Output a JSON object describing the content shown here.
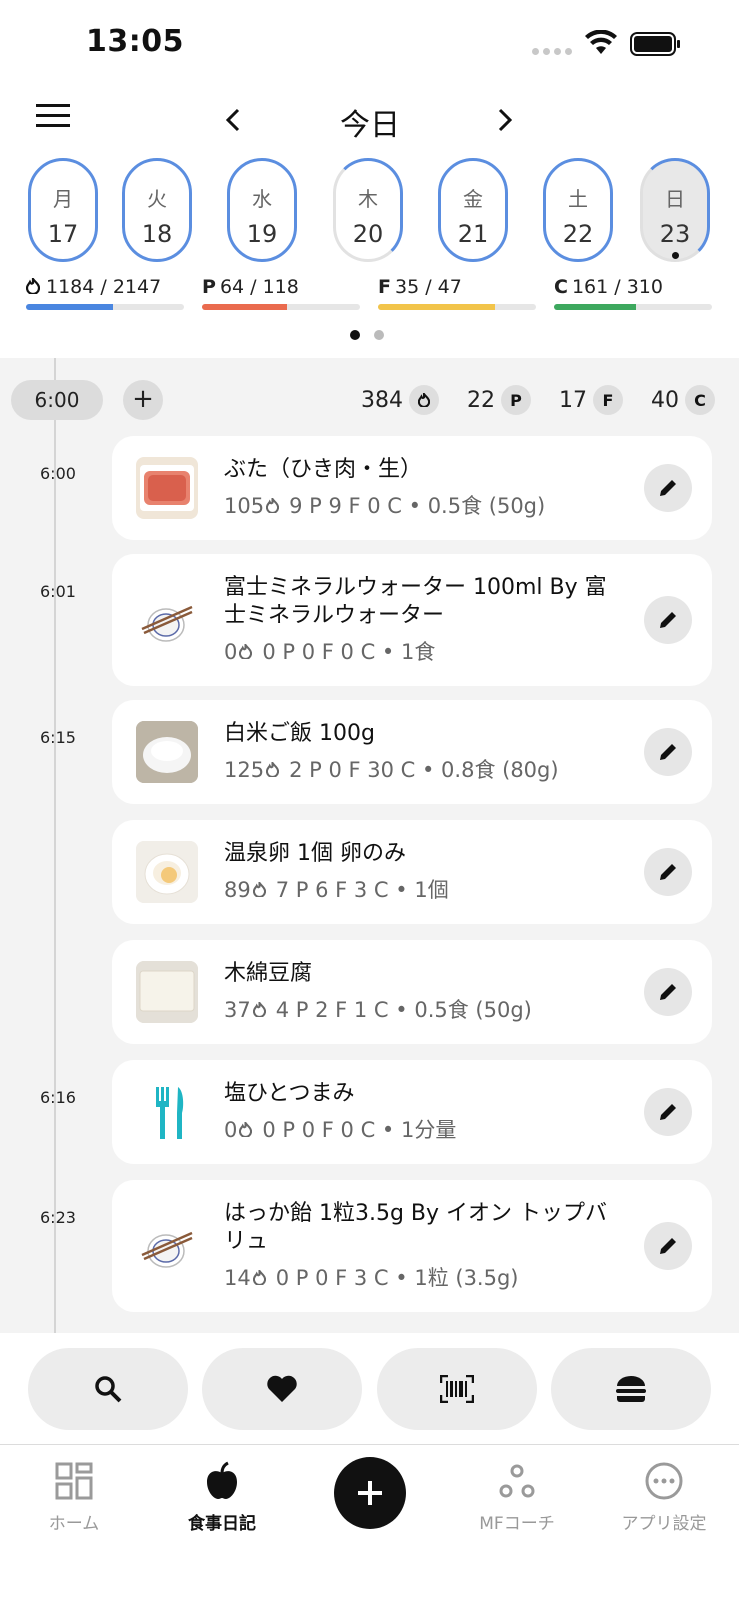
{
  "status": {
    "time": "13:05"
  },
  "header": {
    "title": "今日"
  },
  "week": [
    {
      "name": "月",
      "num": "17"
    },
    {
      "name": "火",
      "num": "18"
    },
    {
      "name": "水",
      "num": "19"
    },
    {
      "name": "木",
      "num": "20"
    },
    {
      "name": "金",
      "num": "21"
    },
    {
      "name": "土",
      "num": "22"
    },
    {
      "name": "日",
      "num": "23"
    }
  ],
  "macros": {
    "kcal": {
      "text": "1184 / 2147",
      "progress": 0.55,
      "color": "#4a86e0"
    },
    "protein": {
      "label": "P",
      "text": "64 / 118",
      "progress": 0.54,
      "color": "#ea6b4e"
    },
    "fat": {
      "label": "F",
      "text": "35 / 47",
      "progress": 0.74,
      "color": "#f2c44a"
    },
    "carbs": {
      "label": "C",
      "text": "161 / 310",
      "progress": 0.52,
      "color": "#3da85e"
    }
  },
  "log": {
    "time_pill": "6:00",
    "add_label": "+",
    "totals": {
      "kcal": "384",
      "p": "22",
      "p_label": "P",
      "f": "17",
      "f_label": "F",
      "c": "40",
      "c_label": "C"
    },
    "entries": [
      {
        "time": "6:00",
        "name": "ぶた（ひき肉・生）",
        "kcal": "105",
        "sub": "9 P  9 F  0 C • 0.5食 (50g)",
        "thumb": "meat"
      },
      {
        "time": "6:01",
        "name": "富士ミネラルウォーター 100ml By 富士ミネラルウォーター",
        "kcal": "0",
        "sub": "0 P  0 F  0 C • 1食",
        "thumb": "bowl-chopsticks"
      },
      {
        "time": "6:15",
        "name": "白米ご飯 100g",
        "kcal": "125",
        "sub": "2 P  0 F  30 C • 0.8食 (80g)",
        "thumb": "rice"
      },
      {
        "time": "",
        "name": "温泉卵 1個 卵のみ",
        "kcal": "89",
        "sub": "7 P  6 F  3 C • 1個",
        "thumb": "egg"
      },
      {
        "time": "",
        "name": "木綿豆腐",
        "kcal": "37",
        "sub": "4 P  2 F  1 C • 0.5食 (50g)",
        "thumb": "tofu"
      },
      {
        "time": "6:16",
        "name": "塩ひとつまみ",
        "kcal": "0",
        "sub": "0 P  0 F  0 C • 1分量",
        "thumb": "cutlery"
      },
      {
        "time": "6:23",
        "name": "はっか飴 1粒3.5g By イオン トップバリュ",
        "kcal": "14",
        "sub": "0 P  0 F  3 C • 1粒 (3.5g)",
        "thumb": "bowl-chopsticks"
      }
    ]
  },
  "quick_actions": [
    "search-icon",
    "heart-icon",
    "barcode-icon",
    "burger-icon"
  ],
  "tabs": [
    {
      "label": "ホーム",
      "icon": "grid-icon"
    },
    {
      "label": "食事日記",
      "icon": "apple-icon"
    },
    {
      "label": "MFコーチ",
      "icon": "coach-icon"
    },
    {
      "label": "アプリ設定",
      "icon": "more-icon"
    }
  ]
}
